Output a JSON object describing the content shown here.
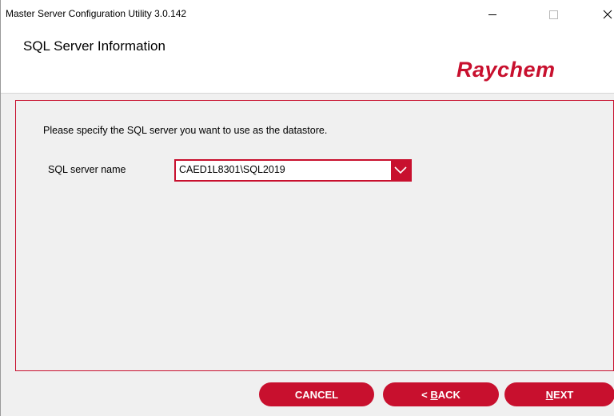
{
  "window": {
    "title": "Master Server Configuration Utility 3.0.142"
  },
  "header": {
    "page_title": "SQL Server Information",
    "logo_text": "Raychem"
  },
  "content": {
    "instruction": "Please specify the SQL server you want to use as the datastore.",
    "sql_server_label": "SQL server name",
    "sql_server_value": "CAED1L8301\\SQL2019"
  },
  "buttons": {
    "cancel_label": "CANCEL",
    "back_prefix": "< ",
    "back_mnemonic": "B",
    "back_rest": "ACK",
    "next_mnemonic": "N",
    "next_rest": "EXT"
  },
  "colors": {
    "accent": "#c8102e",
    "background": "#f0f0f0"
  },
  "icons": {
    "minimize": "minimize-icon",
    "maximize": "maximize-icon",
    "close": "close-icon",
    "dropdown": "chevron-down-icon"
  }
}
